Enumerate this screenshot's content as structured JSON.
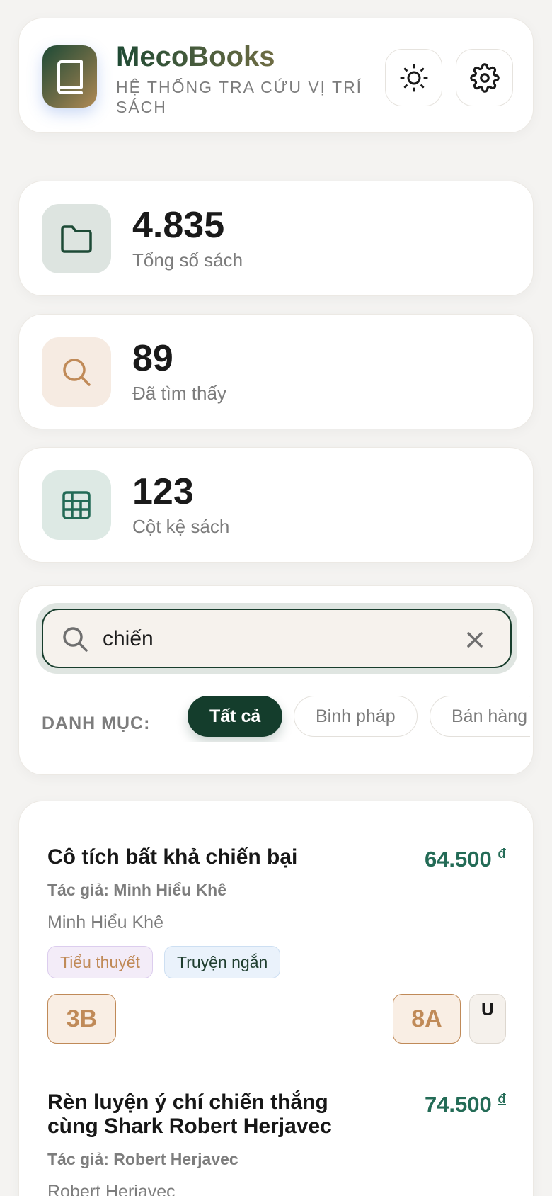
{
  "header": {
    "logo_icon": "book-icon",
    "title": "MecoBooks",
    "subtitle": "HỆ THỐNG TRA CỨU VỊ TRÍ SÁCH",
    "theme_icon": "sun-icon",
    "settings_icon": "gear-icon"
  },
  "stats": [
    {
      "icon": "folder-icon",
      "value": "4.835",
      "label": "Tổng số sách",
      "icon_bg": "#dde4e0",
      "icon_color": "#1d4a36"
    },
    {
      "icon": "search-icon",
      "value": "89",
      "label": "Đã tìm thấy",
      "icon_bg": "#f6ebe2",
      "icon_color": "#c08a58"
    },
    {
      "icon": "grid-icon",
      "value": "123",
      "label": "Cột kệ sách",
      "icon_bg": "#dde9e4",
      "icon_color": "#236b56"
    }
  ],
  "search": {
    "value": "chiến",
    "search_icon": "search-icon",
    "clear_icon": "close-icon"
  },
  "categories": {
    "label": "DANH MỤC:",
    "items": [
      "Tất cả",
      "Binh pháp",
      "Bán hàng"
    ],
    "active_index": 0
  },
  "results": [
    {
      "title": "Cô tích bất khả chiến bại",
      "price": "64.500",
      "currency": "đ",
      "author_line": "Tác giả: Minh Hiểu Khê",
      "author": "Minh Hiểu Khê",
      "tags": [
        "Tiểu thuyết",
        "Truyện ngắn"
      ],
      "locations": [
        "3B",
        "8A",
        "U"
      ]
    },
    {
      "title": "Rèn luyện ý chí chiến thắng cùng Shark Robert Herjavec",
      "price": "74.500",
      "currency": "đ",
      "author_line": "Tác giả: Robert Herjavec",
      "author": "Robert Herjavec"
    }
  ],
  "colors": {
    "primary": "#143d2c",
    "accent": "#c08a58",
    "price": "#236b56"
  }
}
